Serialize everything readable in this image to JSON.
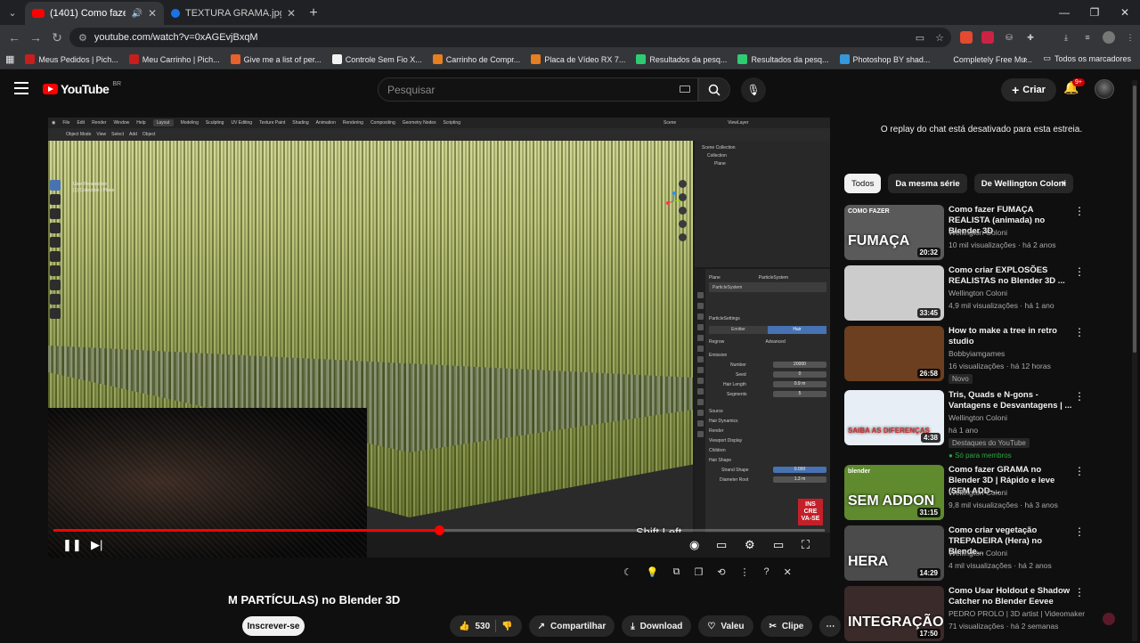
{
  "browser": {
    "tabs": [
      {
        "title": "(1401) Como fazer GRAMA",
        "active": true,
        "favicon_color": "#ff0000"
      },
      {
        "title": "TEXTURA GRAMA.jpg - Google",
        "active": false,
        "favicon_color": "#1a73e8"
      }
    ],
    "url": "youtube.com/watch?v=0xAGEvjBxqM",
    "bookmarks": [
      {
        "label": "Meus Pedidos | Pich...",
        "color": "#c81e1e"
      },
      {
        "label": "Meu Carrinho | Pich...",
        "color": "#c81e1e"
      },
      {
        "label": "Give me a list of per...",
        "color": "#e8612c"
      },
      {
        "label": "Controle Sem Fio X...",
        "color": "#f2f2f2"
      },
      {
        "label": "Carrinho de Compr...",
        "color": "#e67e22"
      },
      {
        "label": "Placa de Vídeo RX 7...",
        "color": "#e67e22"
      },
      {
        "label": "Resultados da pesq...",
        "color": "#2ecc71"
      },
      {
        "label": "Resultados da pesq...",
        "color": "#2ecc71"
      },
      {
        "label": "Photoshop BY shad...",
        "color": "#3498db"
      },
      {
        "label": "Completely Free Mu...",
        "color": "#555555"
      }
    ],
    "all_bookmarks": "Todos os marcadores"
  },
  "youtube": {
    "logo": "YouTube",
    "region": "BR",
    "search_placeholder": "Pesquisar",
    "create_label": "Criar",
    "notif_badge": "9+"
  },
  "video": {
    "overlay_text": "Shift Left",
    "title_visible": "M PARTÍCULAS) no Blender 3D",
    "subscribe": "Inscrever-se",
    "likes": "530",
    "share": "Compartilhar",
    "download": "Download",
    "thanks": "Valeu",
    "clip": "Clipe",
    "progress_fraction": 0.5,
    "blender": {
      "menus": [
        "File",
        "Edit",
        "Render",
        "Window",
        "Help"
      ],
      "workspaces": [
        "Layout",
        "Modeling",
        "Sculpting",
        "UV Editing",
        "Texture Paint",
        "Shading",
        "Animation",
        "Rendering",
        "Compositing",
        "Geometry Nodes",
        "Scripting"
      ],
      "mode": "Object Mode",
      "view_menus": [
        "View",
        "Select",
        "Add",
        "Object"
      ],
      "viewport_label1": "User Perspective",
      "viewport_label2": "(1) Collection | Plane",
      "scene": "Scene",
      "view_layer": "ViewLayer",
      "outliner": [
        "Scene Collection",
        "Collection",
        "Plane"
      ],
      "object": "Plane",
      "particle_system": "ParticleSystem",
      "particle_settings": "ParticleSettings",
      "emitter": "Emitter",
      "hair": "Hair",
      "regrow": "Regrow",
      "advanced": "Advanced",
      "emission": "Emission",
      "number_label": "Number",
      "number": "20000",
      "seed_label": "Seed",
      "seed": "0",
      "hair_length_label": "Hair Length",
      "hair_length": "0.9 m",
      "segments_label": "Segments",
      "segments": "5",
      "sections": [
        "Source",
        "Hair Dynamics",
        "Render",
        "Viewport Display",
        "Children",
        "Hair Shape"
      ],
      "strand_shape_label": "Strand Shape",
      "strand_shape": "0.000",
      "diameter_root_label": "Diameter Root",
      "diameter_root": "1.3 m",
      "options": "Options",
      "insc_badge": "INS CRE VA-SE"
    }
  },
  "sidebar": {
    "chat_note": "O replay do chat está desativado para esta estreia.",
    "chips": [
      "Todos",
      "Da mesma série",
      "De Wellington Coloni"
    ],
    "recommendations": [
      {
        "title": "Como fazer FUMAÇA REALISTA (animada) no Blender 3D",
        "channel": "Wellington Coloni",
        "meta": "10 mil visualizações · há 2 anos",
        "duration": "20:32",
        "thumb_text": "FUMAÇA",
        "thumb_sub": "COMO FAZER",
        "bg": "#5a5a5a"
      },
      {
        "title": "Como criar EXPLOSÕES REALISTAS no Blender 3D ...",
        "channel": "Wellington Coloni",
        "meta": "4,9 mil visualizações · há 1 ano",
        "duration": "33:45",
        "thumb_text": "",
        "thumb_sub": "",
        "bg": "#cccccc"
      },
      {
        "title": "How to make a tree in retro studio",
        "channel": "Bobbyiamgames",
        "meta": "16 visualizações · há 12 horas",
        "duration": "26:58",
        "thumb_text": "",
        "thumb_sub": "",
        "bg": "#6b3f20",
        "tag": "Novo"
      },
      {
        "title": "Tris, Quads e N-gons - Vantagens e Desvantagens | ...",
        "channel": "Wellington Coloni",
        "meta": "há 1 ano",
        "duration": "4:38",
        "thumb_text": "SAIBA AS DIFERENÇAS",
        "thumb_sub": "",
        "bg": "#e8eef5",
        "tag": "Destaques do YouTube",
        "members": "Só para membros"
      },
      {
        "title": "Como fazer GRAMA no Blender 3D | Rápido e leve (SEM ADD-...",
        "channel": "Wellington Coloni",
        "meta": "9,8 mil visualizações · há 3 anos",
        "duration": "31:15",
        "thumb_text": "SEM ADDON",
        "thumb_sub": "blender",
        "bg": "#5f8a2e"
      },
      {
        "title": "Como criar vegetação TREPADEIRA (Hera) no Blende...",
        "channel": "Wellington Coloni",
        "meta": "4 mil visualizações · há 2 anos",
        "duration": "14:29",
        "thumb_text": "HERA",
        "thumb_sub": "",
        "bg": "#4b4b4b"
      },
      {
        "title": "Como Usar Holdout e Shadow Catcher no Blender Eevee",
        "channel": "PEDRO PROLO | 3D artist | Videomaker",
        "meta": "71 visualizações · há 2 semanas",
        "duration": "17:50",
        "thumb_text": "INTEGRAÇÃO",
        "thumb_sub": "",
        "bg": "#3a2a2a"
      }
    ]
  }
}
